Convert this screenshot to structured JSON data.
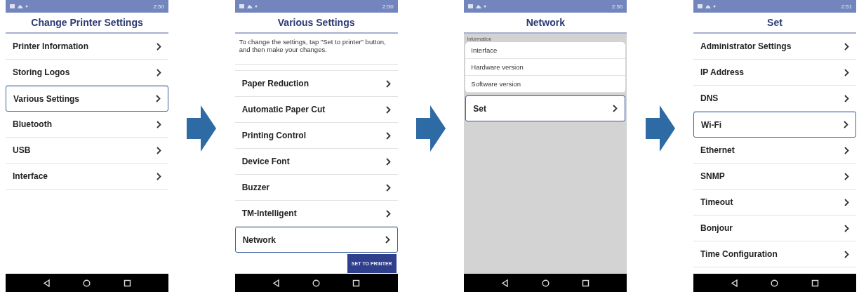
{
  "screens": [
    {
      "kind": "list",
      "time": "2:50",
      "title": "Change Printer Settings",
      "items": [
        {
          "label": "Printer Information",
          "selected": false
        },
        {
          "label": "Storing Logos",
          "selected": false
        },
        {
          "label": "Various Settings",
          "selected": true
        },
        {
          "label": "Bluetooth",
          "selected": false
        },
        {
          "label": "USB",
          "selected": false
        },
        {
          "label": "Interface",
          "selected": false
        }
      ]
    },
    {
      "kind": "list",
      "time": "2:50",
      "title": "Various Settings",
      "note": "To change the settings, tap \"Set to printer\" button, and then make your changes.",
      "items": [
        {
          "label": "Paper Reduction",
          "selected": false
        },
        {
          "label": "Automatic Paper Cut",
          "selected": false
        },
        {
          "label": "Printing Control",
          "selected": false
        },
        {
          "label": "Device Font",
          "selected": false
        },
        {
          "label": "Buzzer",
          "selected": false
        },
        {
          "label": "TM-Intelligent",
          "selected": false
        },
        {
          "label": "Network",
          "selected": true
        }
      ],
      "action_button": "SET TO PRINTER"
    },
    {
      "kind": "form",
      "time": "2:50",
      "title": "Network",
      "section_label": "Information",
      "info_rows": [
        "Interface",
        "Hardware version",
        "Software version"
      ],
      "items": [
        {
          "label": "Set",
          "selected": true
        }
      ]
    },
    {
      "kind": "list",
      "time": "2:51",
      "title": "Set",
      "items": [
        {
          "label": "Administrator Settings",
          "selected": false
        },
        {
          "label": "IP Address",
          "selected": false
        },
        {
          "label": "DNS",
          "selected": false
        },
        {
          "label": "Wi-Fi",
          "selected": true
        },
        {
          "label": "Ethernet",
          "selected": false
        },
        {
          "label": "SNMP",
          "selected": false
        },
        {
          "label": "Timeout",
          "selected": false
        },
        {
          "label": "Bonjour",
          "selected": false
        },
        {
          "label": "Time Configuration",
          "selected": false
        }
      ]
    }
  ]
}
